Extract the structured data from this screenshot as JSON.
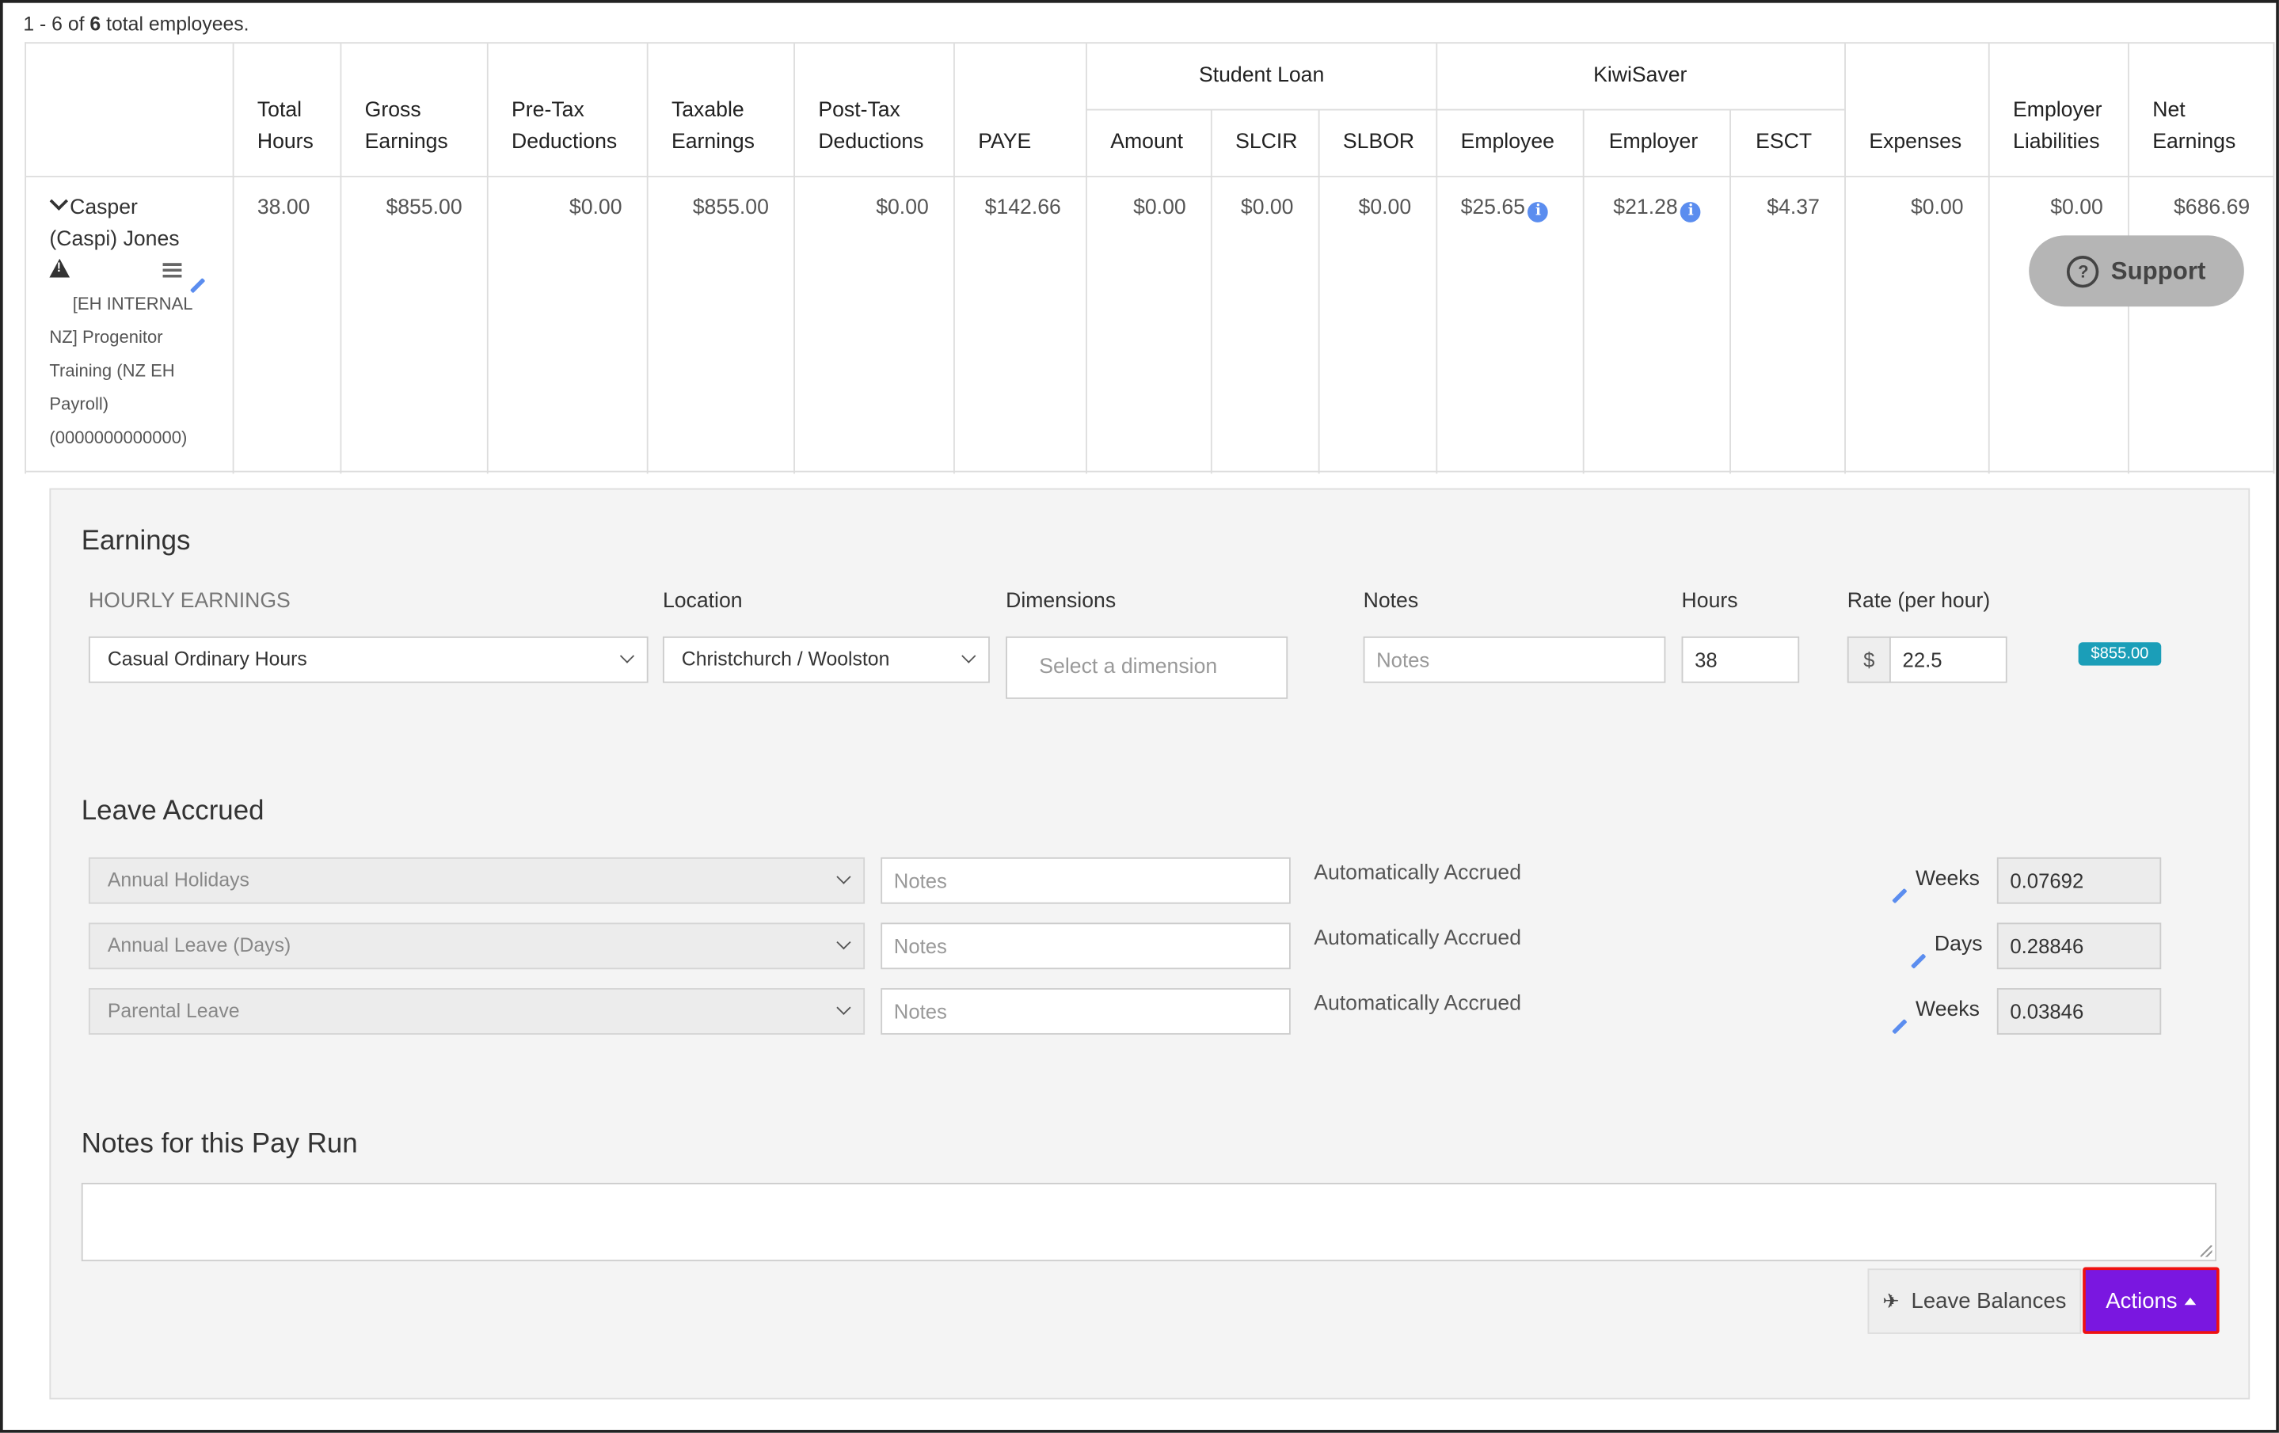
{
  "summary": {
    "prefix": "1 - 6 of",
    "count": "6",
    "suffix": "total employees."
  },
  "table": {
    "headers": {
      "total_hours": [
        "Total",
        "Hours"
      ],
      "gross_earnings": [
        "Gross",
        "Earnings"
      ],
      "pretax_deductions": [
        "Pre-Tax",
        "Deductions"
      ],
      "taxable_earnings": [
        "Taxable",
        "Earnings"
      ],
      "posttax_deductions": [
        "Post-Tax",
        "Deductions"
      ],
      "paye": "PAYE",
      "student_loan_group": "Student Loan",
      "sl_amount": "Amount",
      "sl_slcir": "SLCIR",
      "sl_slbor": "SLBOR",
      "kiwisaver_group": "KiwiSaver",
      "ks_employee": "Employee",
      "ks_employer": "Employer",
      "ks_esct": "ESCT",
      "expenses": "Expenses",
      "employer_liabilities": [
        "Employer",
        "Liabilities"
      ],
      "net_earnings": [
        "Net",
        "Earnings"
      ]
    },
    "row": {
      "name_line1": "Casper",
      "name_line2": "(Caspi) Jones",
      "org_lines": [
        "[EH INTERNAL",
        "NZ] Progenitor",
        "Training (NZ EH",
        "Payroll)",
        "(0000000000000)"
      ],
      "total_hours": "38.00",
      "gross_earnings": "$855.00",
      "pretax_deductions": "$0.00",
      "taxable_earnings": "$855.00",
      "posttax_deductions": "$0.00",
      "paye": "$142.66",
      "sl_amount": "$0.00",
      "sl_slcir": "$0.00",
      "sl_slbor": "$0.00",
      "ks_employee": "$25.65",
      "ks_employer": "$21.28",
      "ks_esct": "$4.37",
      "expenses": "$0.00",
      "employer_liabilities": "$0.00",
      "net_earnings": "$686.69"
    }
  },
  "support_button": "Support",
  "earnings": {
    "title": "Earnings",
    "col_hourly": "HOURLY EARNINGS",
    "col_location": "Location",
    "col_dimensions": "Dimensions",
    "col_notes": "Notes",
    "col_hours": "Hours",
    "col_rate": "Rate (per hour)",
    "earning_type": "Casual Ordinary Hours",
    "location": "Christchurch / Woolston",
    "dimension_placeholder": "Select a dimension",
    "notes_placeholder": "Notes",
    "hours": "38",
    "currency": "$",
    "rate": "22.5",
    "total_badge": "$855.00"
  },
  "leave": {
    "title": "Leave Accrued",
    "items": [
      {
        "type": "Annual Holidays",
        "notes_placeholder": "Notes",
        "status": "Automatically Accrued",
        "unit": "Weeks",
        "value": "0.07692"
      },
      {
        "type": "Annual Leave (Days)",
        "notes_placeholder": "Notes",
        "status": "Automatically Accrued",
        "unit": "Days",
        "value": "0.28846"
      },
      {
        "type": "Parental Leave",
        "notes_placeholder": "Notes",
        "status": "Automatically Accrued",
        "unit": "Weeks",
        "value": "0.03846"
      }
    ]
  },
  "pay_run_notes": {
    "title": "Notes for this Pay Run",
    "value": ""
  },
  "buttons": {
    "leave_balances": "Leave Balances",
    "actions": "Actions"
  },
  "colors": {
    "actions_bg": "#7a17e0",
    "actions_border": "#ee1111",
    "badge": "#1b9eb8",
    "support_bg": "#b5b5b5",
    "info_icon": "#5b8def"
  }
}
